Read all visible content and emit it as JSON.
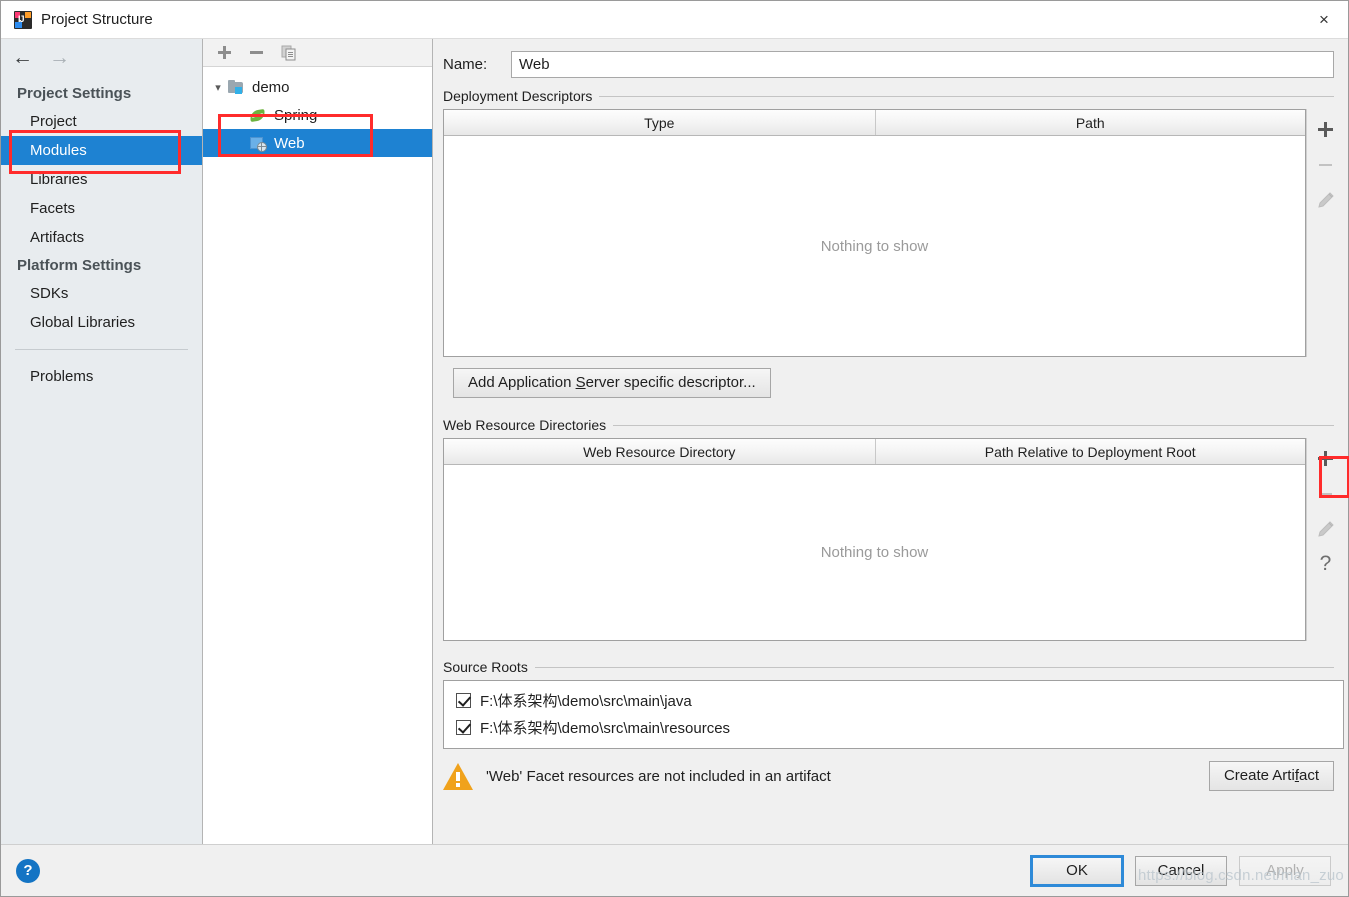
{
  "window": {
    "title": "Project Structure",
    "app_icon": "intellij-idea-icon",
    "close_label": "×"
  },
  "sidebar": {
    "nav_back_icon": "arrow-left-icon",
    "nav_forward_icon": "arrow-right-icon",
    "groups": [
      {
        "label": "Project Settings",
        "items": [
          {
            "label": "Project",
            "selected": false
          },
          {
            "label": "Modules",
            "selected": true
          },
          {
            "label": "Libraries",
            "selected": false
          },
          {
            "label": "Facets",
            "selected": false
          },
          {
            "label": "Artifacts",
            "selected": false
          }
        ]
      },
      {
        "label": "Platform Settings",
        "items": [
          {
            "label": "SDKs",
            "selected": false
          },
          {
            "label": "Global Libraries",
            "selected": false
          }
        ]
      }
    ],
    "problems": {
      "label": "Problems"
    }
  },
  "tree": {
    "toolbar": {
      "add": "+",
      "remove": "−",
      "copy_icon": "copy-icon"
    },
    "nodes": [
      {
        "label": "demo",
        "icon": "module-folder-icon",
        "level": 0,
        "expanded": true,
        "selected": false
      },
      {
        "label": "Spring",
        "icon": "spring-leaf-icon",
        "level": 1,
        "expanded": false,
        "selected": false
      },
      {
        "label": "Web",
        "icon": "web-facet-icon",
        "level": 1,
        "expanded": false,
        "selected": true
      }
    ]
  },
  "detail": {
    "name_label": "Name:",
    "name_value": "Web",
    "deployment_descriptors": {
      "title": "Deployment Descriptors",
      "columns": [
        "Type",
        "Path"
      ],
      "rows": [],
      "empty_text": "Nothing to show",
      "toolbar": [
        {
          "name": "add",
          "glyph": "+",
          "enabled": true
        },
        {
          "name": "remove",
          "glyph": "−",
          "enabled": false
        },
        {
          "name": "edit",
          "glyph": "pencil-icon",
          "enabled": false
        }
      ]
    },
    "add_descriptor_button": {
      "pre": "Add Application ",
      "mnemonic": "S",
      "post": "erver specific descriptor..."
    },
    "web_resource_directories": {
      "title": "Web Resource Directories",
      "columns": [
        "Web Resource Directory",
        "Path Relative to Deployment Root"
      ],
      "rows": [],
      "empty_text": "Nothing to show",
      "toolbar": [
        {
          "name": "add",
          "glyph": "+",
          "enabled": true
        },
        {
          "name": "remove",
          "glyph": "−",
          "enabled": false
        },
        {
          "name": "edit",
          "glyph": "pencil-icon",
          "enabled": false
        },
        {
          "name": "help",
          "glyph": "?",
          "enabled": true
        }
      ]
    },
    "source_roots": {
      "title": "Source Roots",
      "items": [
        {
          "label": "F:\\体系架构\\demo\\src\\main\\java",
          "checked": true
        },
        {
          "label": "F:\\体系架构\\demo\\src\\main\\resources",
          "checked": true
        }
      ]
    },
    "warning": {
      "icon": "warning-triangle-icon",
      "text": "'Web' Facet resources are not included in an artifact",
      "action": {
        "pre": "Create Arti",
        "mnemonic": "f",
        "post": "act"
      }
    }
  },
  "footer": {
    "help_icon": "help-circle-icon",
    "help_glyph": "?",
    "ok_label": "OK",
    "cancel_label": "Cancel",
    "apply_label": "Apply"
  },
  "watermark": {
    "text": "https://blog.csdn.net/man_zuo"
  },
  "colors": {
    "selection_blue": "#1e82d2",
    "annotation_red": "#ff2b2b",
    "warning_orange": "#f0a21c",
    "help_blue": "#1474c4"
  }
}
